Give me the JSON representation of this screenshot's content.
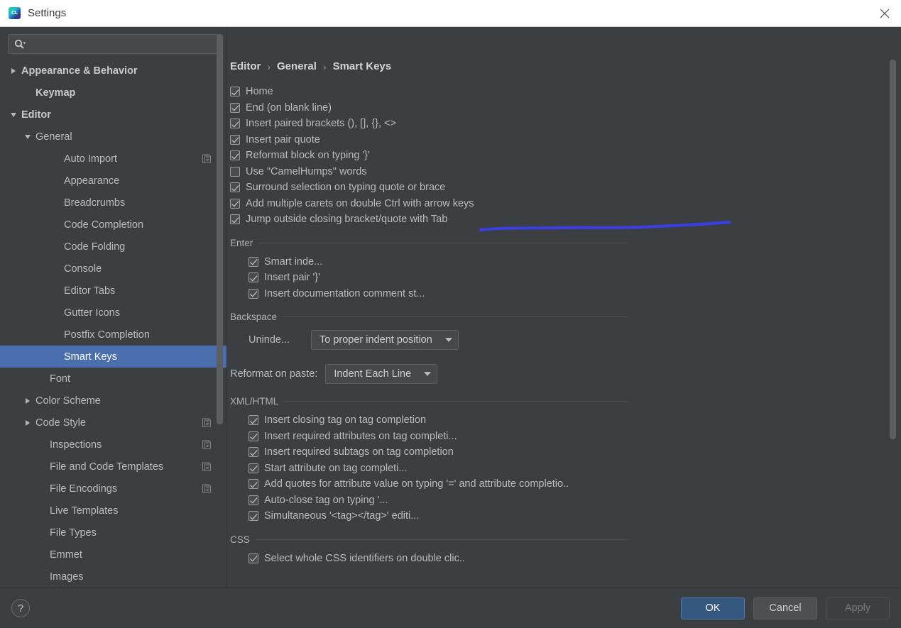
{
  "window": {
    "title": "Settings",
    "app_icon": "clion-icon",
    "close_icon": "close-icon"
  },
  "search": {
    "value": "",
    "placeholder": "",
    "icon": "search-icon"
  },
  "sidebar": {
    "scrollbar": "sidebar-scrollbar",
    "items": [
      {
        "label": "Appearance & Behavior",
        "indent": 0,
        "twisty": "right",
        "bold": true,
        "selected": false,
        "config_icon": false
      },
      {
        "label": "Keymap",
        "indent": 1,
        "twisty": "none",
        "bold": true,
        "selected": false,
        "config_icon": false
      },
      {
        "label": "Editor",
        "indent": 0,
        "twisty": "down",
        "bold": true,
        "selected": false,
        "config_icon": false
      },
      {
        "label": "General",
        "indent": 1,
        "twisty": "down",
        "bold": false,
        "selected": false,
        "config_icon": false
      },
      {
        "label": "Auto Import",
        "indent": 3,
        "twisty": "none",
        "bold": false,
        "selected": false,
        "config_icon": true
      },
      {
        "label": "Appearance",
        "indent": 3,
        "twisty": "none",
        "bold": false,
        "selected": false,
        "config_icon": false
      },
      {
        "label": "Breadcrumbs",
        "indent": 3,
        "twisty": "none",
        "bold": false,
        "selected": false,
        "config_icon": false
      },
      {
        "label": "Code Completion",
        "indent": 3,
        "twisty": "none",
        "bold": false,
        "selected": false,
        "config_icon": false
      },
      {
        "label": "Code Folding",
        "indent": 3,
        "twisty": "none",
        "bold": false,
        "selected": false,
        "config_icon": false
      },
      {
        "label": "Console",
        "indent": 3,
        "twisty": "none",
        "bold": false,
        "selected": false,
        "config_icon": false
      },
      {
        "label": "Editor Tabs",
        "indent": 3,
        "twisty": "none",
        "bold": false,
        "selected": false,
        "config_icon": false
      },
      {
        "label": "Gutter Icons",
        "indent": 3,
        "twisty": "none",
        "bold": false,
        "selected": false,
        "config_icon": false
      },
      {
        "label": "Postfix Completion",
        "indent": 3,
        "twisty": "none",
        "bold": false,
        "selected": false,
        "config_icon": false
      },
      {
        "label": "Smart Keys",
        "indent": 3,
        "twisty": "none",
        "bold": false,
        "selected": true,
        "config_icon": false
      },
      {
        "label": "Font",
        "indent": 2,
        "twisty": "none",
        "bold": false,
        "selected": false,
        "config_icon": false
      },
      {
        "label": "Color Scheme",
        "indent": 1,
        "twisty": "right",
        "bold": false,
        "selected": false,
        "config_icon": false
      },
      {
        "label": "Code Style",
        "indent": 1,
        "twisty": "right",
        "bold": false,
        "selected": false,
        "config_icon": true
      },
      {
        "label": "Inspections",
        "indent": 2,
        "twisty": "none",
        "bold": false,
        "selected": false,
        "config_icon": true
      },
      {
        "label": "File and Code Templates",
        "indent": 2,
        "twisty": "none",
        "bold": false,
        "selected": false,
        "config_icon": true
      },
      {
        "label": "File Encodings",
        "indent": 2,
        "twisty": "none",
        "bold": false,
        "selected": false,
        "config_icon": true
      },
      {
        "label": "Live Templates",
        "indent": 2,
        "twisty": "none",
        "bold": false,
        "selected": false,
        "config_icon": false
      },
      {
        "label": "File Types",
        "indent": 2,
        "twisty": "none",
        "bold": false,
        "selected": false,
        "config_icon": false
      },
      {
        "label": "Emmet",
        "indent": 2,
        "twisty": "none",
        "bold": false,
        "selected": false,
        "config_icon": false
      },
      {
        "label": "Images",
        "indent": 2,
        "twisty": "none",
        "bold": false,
        "selected": false,
        "config_icon": false
      }
    ]
  },
  "main": {
    "breadcrumb": [
      "Editor",
      "General",
      "Smart Keys"
    ],
    "breadcrumb_separator": "›",
    "scrollbar": "main-scrollbar",
    "top_checkboxes": [
      {
        "label": "Home",
        "checked": true
      },
      {
        "label": "End (on blank line)",
        "checked": true
      },
      {
        "label": "Insert paired brackets (), [], {}, <>",
        "checked": true
      },
      {
        "label": "Insert pair quote",
        "checked": true
      },
      {
        "label": "Reformat block on typing '}'",
        "checked": true
      },
      {
        "label": "Use \"CamelHumps\" words",
        "checked": false
      },
      {
        "label": "Surround selection on typing quote or brace",
        "checked": true
      },
      {
        "label": "Add multiple carets on double Ctrl with arrow keys",
        "checked": true
      },
      {
        "label": "Jump outside closing bracket/quote with Tab",
        "checked": true
      }
    ],
    "enter_group": {
      "title": "Enter",
      "checkboxes": [
        {
          "label": "Smart inde...",
          "checked": true
        },
        {
          "label": "Insert pair '}'",
          "checked": true
        },
        {
          "label": "Insert documentation comment st...",
          "checked": true
        }
      ]
    },
    "backspace_group": {
      "title": "Backspace",
      "unindent_label": "Uninde...",
      "unindent_value": "To proper indent position",
      "reformat_label": "Reformat on paste:",
      "reformat_value": "Indent Each Line"
    },
    "xmlhtml_group": {
      "title": "XML/HTML",
      "checkboxes": [
        {
          "label": "Insert closing tag on tag completion",
          "checked": true
        },
        {
          "label": "Insert required attributes on tag completi...",
          "checked": true
        },
        {
          "label": "Insert required subtags on tag completion",
          "checked": true
        },
        {
          "label": "Start attribute on tag completi...",
          "checked": true
        },
        {
          "label": "Add quotes for attribute value on typing '=' and attribute completio..",
          "checked": true
        },
        {
          "label": "Auto-close tag on typing '...",
          "checked": true
        },
        {
          "label": "Simultaneous '<tag></tag>' editi...",
          "checked": true
        }
      ]
    },
    "css_group": {
      "title": "CSS",
      "checkboxes": [
        {
          "label": "Select whole CSS identifiers on double clic..",
          "checked": true
        }
      ]
    },
    "annotation": {
      "type": "freehand-underline",
      "color": "#3b3fe0",
      "target": "Jump outside closing bracket/quote with Tab"
    }
  },
  "footer": {
    "help_label": "?",
    "ok_label": "OK",
    "cancel_label": "Cancel",
    "apply_label": "Apply",
    "apply_disabled": true
  },
  "colors": {
    "background": "#3c3f41",
    "selection": "#4b6eaf",
    "primary_button": "#365880",
    "titlebar": "#ffffff",
    "annotation": "#3b3fe0",
    "text": "#bbbbbb"
  }
}
